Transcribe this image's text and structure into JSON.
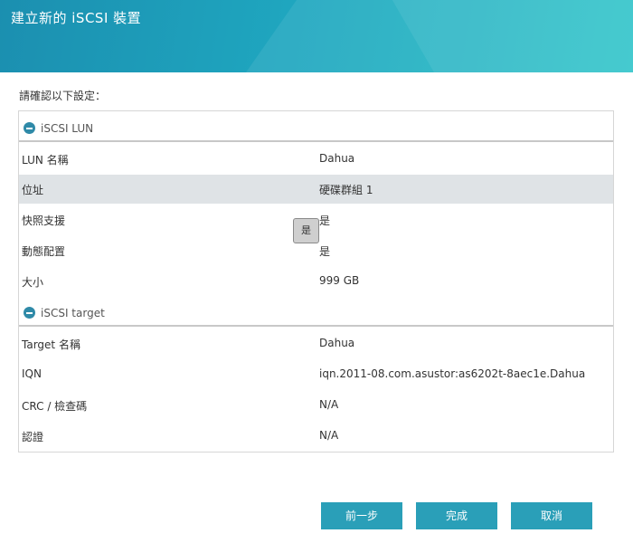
{
  "header": {
    "title": "建立新的 iSCSI 裝置"
  },
  "prompt": "請確認以下設定：",
  "lun_section": {
    "title": "iSCSI LUN",
    "rows": [
      {
        "key": "LUN 名稱",
        "value": "Dahua"
      },
      {
        "key": "位址",
        "value": "硬碟群組 1"
      },
      {
        "key": "快照支援",
        "value": "是"
      },
      {
        "key": "動態配置",
        "value": "是"
      },
      {
        "key": "大小",
        "value": "999 GB"
      }
    ]
  },
  "target_section": {
    "title": "iSCSI target",
    "rows": [
      {
        "key": "Target 名稱",
        "value": "Dahua"
      },
      {
        "key": "IQN",
        "value": "iqn.2011-08.com.asustor:as6202t-8aec1e.Dahua"
      },
      {
        "key": "CRC / 檢查碼",
        "value": "N/A"
      },
      {
        "key": "認證",
        "value": "N/A"
      }
    ]
  },
  "tooltip": "是",
  "buttons": {
    "back": "前一步",
    "finish": "完成",
    "cancel": "取消"
  },
  "colors": {
    "accent": "#2a9fb8",
    "section_icon": "#2f8aa8",
    "highlight_row": "#dfe3e6"
  }
}
